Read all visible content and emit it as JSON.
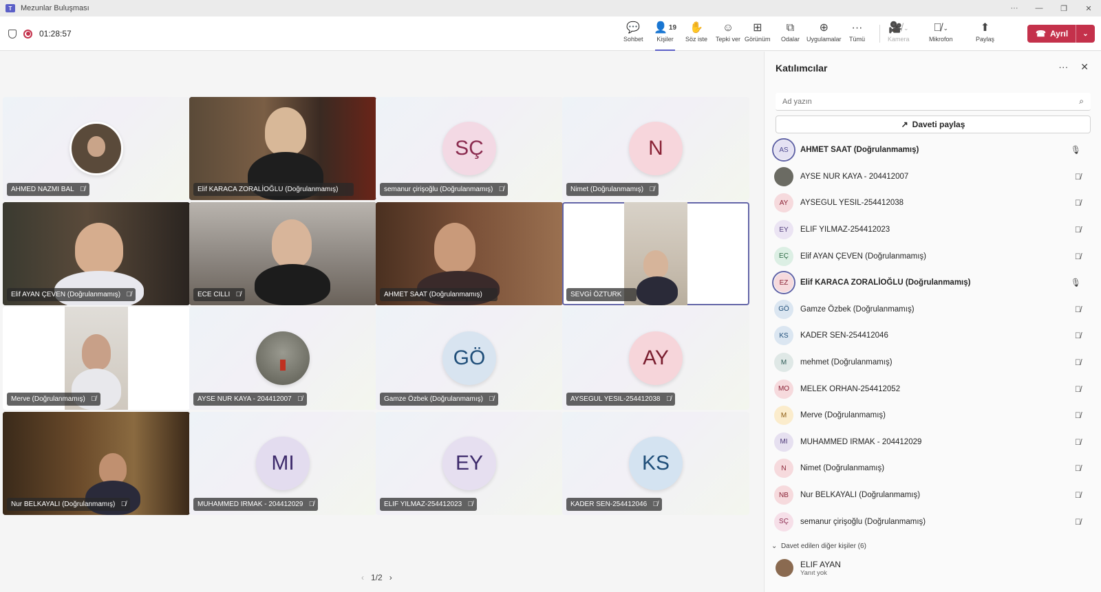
{
  "window": {
    "title": "Mezunlar Buluşması",
    "controls": [
      "···",
      "—",
      "❐",
      "✕"
    ]
  },
  "meeting": {
    "elapsed": "01:28:57"
  },
  "toolbar": {
    "chat": "Sohbet",
    "people": "Kişiler",
    "people_count": "19",
    "raise_hand": "Söz iste",
    "react": "Tepki ver",
    "view": "Görünüm",
    "rooms": "Odalar",
    "apps": "Uygulamalar",
    "more": "Tümü",
    "camera": "Kamera",
    "mic": "Mikrofon",
    "share": "Paylaş",
    "leave": "Ayrıl"
  },
  "tiles": [
    {
      "name": "AHMED NAZMI BAL",
      "kind": "photo"
    },
    {
      "name": "Elif KARACA ZORALİOĞLU (Doğrulanmamış)",
      "kind": "video"
    },
    {
      "name": "semanur çirişoğlu (Doğrulanmamış)",
      "initials": "SÇ",
      "bg": "#f3d9e4",
      "fg": "#8a2a4e"
    },
    {
      "name": "Nimet (Doğrulanmamış)",
      "initials": "N",
      "bg": "#f7d6dc",
      "fg": "#8a2336"
    },
    {
      "name": "Elif AYAN ÇEVEN (Doğrulanmamış)",
      "kind": "video"
    },
    {
      "name": "ECE CILLI",
      "kind": "video"
    },
    {
      "name": "AHMET SAAT (Doğrulanmamış)",
      "kind": "video"
    },
    {
      "name": "SEVGİ ÖZTURK",
      "kind": "video"
    },
    {
      "name": "Merve (Doğrulanmamış)",
      "kind": "video"
    },
    {
      "name": "AYSE NUR KAYA - 204412007",
      "kind": "photo"
    },
    {
      "name": "Gamze Özbek (Doğrulanmamış)",
      "initials": "GÖ",
      "bg": "#d8e4f0",
      "fg": "#1f4e79"
    },
    {
      "name": "AYSEGUL YESIL-254412038",
      "initials": "AY",
      "bg": "#f6d5da",
      "fg": "#7a1f30"
    },
    {
      "name": "Nur BELKAYALI (Doğrulanmamış)",
      "kind": "video"
    },
    {
      "name": "MUHAMMED IRMAK - 204412029",
      "initials": "MI",
      "bg": "#e3dcef",
      "fg": "#3d2a6b"
    },
    {
      "name": "ELIF YILMAZ-254412023",
      "initials": "EY",
      "bg": "#e6dff0",
      "fg": "#3d2a6b"
    },
    {
      "name": "KADER SEN-254412046",
      "initials": "KS",
      "bg": "#d4e3f1",
      "fg": "#1f4e79"
    }
  ],
  "pager": {
    "label": "1/2",
    "prev": "‹",
    "next": "›"
  },
  "panel": {
    "title": "Katılımcılar",
    "search_placeholder": "Ad yazın",
    "invite_label": "Daveti paylaş",
    "participants": [
      {
        "initials": "AS",
        "name": "AHMET SAAT (Doğrulanmamış)",
        "bg": "#e5e2f3",
        "fg": "#4f4b8f",
        "speaking": true
      },
      {
        "initials": "",
        "name": "AYSE NUR KAYA - 204412007",
        "bg": "#6b6b63",
        "fg": "#fff",
        "speaking": false
      },
      {
        "initials": "AY",
        "name": "AYSEGUL YESIL-254412038",
        "bg": "#f6dadd",
        "fg": "#8a2336",
        "speaking": false
      },
      {
        "initials": "EY",
        "name": "ELIF YILMAZ-254412023",
        "bg": "#ebe4f3",
        "fg": "#4f3b7a",
        "speaking": false
      },
      {
        "initials": "EÇ",
        "name": "Elif AYAN ÇEVEN (Doğrulanmamış)",
        "bg": "#dcefe4",
        "fg": "#2d6a45",
        "speaking": false
      },
      {
        "initials": "EZ",
        "name": "Elif KARACA ZORALİOĞLU (Doğrulanmamış)",
        "bg": "#f6dadd",
        "fg": "#8a2336",
        "speaking": true
      },
      {
        "initials": "GÖ",
        "name": "Gamze Özbek (Doğrulanmamış)",
        "bg": "#dbe6f1",
        "fg": "#1f4e79",
        "speaking": false
      },
      {
        "initials": "KS",
        "name": "KADER SEN-254412046",
        "bg": "#dbe6f1",
        "fg": "#1f4e79",
        "speaking": false
      },
      {
        "initials": "M",
        "name": "mehmet (Doğrulanmamış)",
        "bg": "#dfe8e6",
        "fg": "#2d5a55",
        "speaking": false
      },
      {
        "initials": "MO",
        "name": "MELEK ORHAN-254412052",
        "bg": "#f6dadd",
        "fg": "#8a2336",
        "speaking": false
      },
      {
        "initials": "M",
        "name": "Merve (Doğrulanmamış)",
        "bg": "#fbeccc",
        "fg": "#8a5a12",
        "speaking": false
      },
      {
        "initials": "MI",
        "name": "MUHAMMED IRMAK - 204412029",
        "bg": "#e6e0f0",
        "fg": "#4f3b7a",
        "speaking": false
      },
      {
        "initials": "N",
        "name": "Nimet (Doğrulanmamış)",
        "bg": "#f6dadd",
        "fg": "#8a2336",
        "speaking": false
      },
      {
        "initials": "NB",
        "name": "Nur BELKAYALI (Doğrulanmamış)",
        "bg": "#f6dadd",
        "fg": "#8a2336",
        "speaking": false
      },
      {
        "initials": "SÇ",
        "name": "semanur çirişoğlu (Doğrulanmamış)",
        "bg": "#f6dfe8",
        "fg": "#8a2a4e",
        "speaking": false
      }
    ],
    "invited_header": "Davet edilen diğer kişiler (6)",
    "invitee": {
      "name": "ELIF AYAN",
      "status": "Yanıt yok"
    }
  },
  "colors": {
    "accent": "#5b5fc7",
    "leave": "#c4314b"
  }
}
